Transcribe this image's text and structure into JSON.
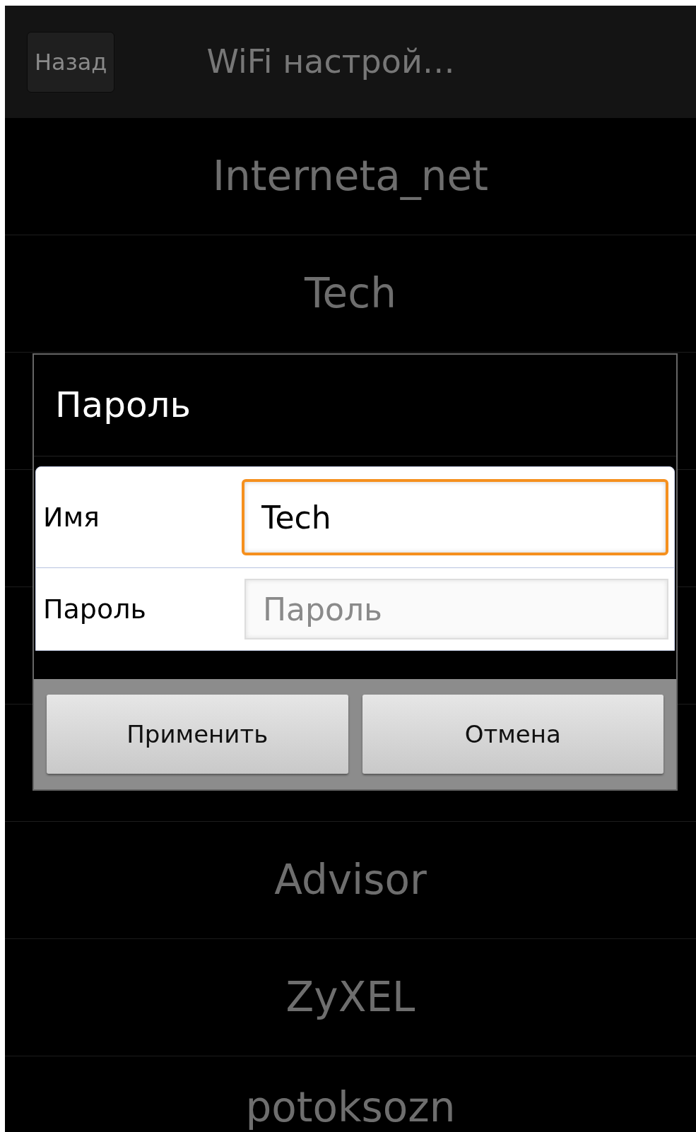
{
  "header": {
    "back_button": "Назад",
    "title": "WiFi настрой…"
  },
  "networks": [
    {
      "name": "Interneta_net"
    },
    {
      "name": "Tech"
    },
    {
      "name": "Advisor"
    },
    {
      "name": "ZyXEL"
    },
    {
      "name": "potoksozn"
    }
  ],
  "dialog": {
    "title": "Пароль",
    "fields": [
      {
        "label": "Имя",
        "value": "Tech",
        "focused": true
      },
      {
        "label": "Пароль",
        "placeholder": "Пароль",
        "focused": false
      }
    ],
    "buttons": [
      "Применить",
      "Отмена"
    ]
  }
}
